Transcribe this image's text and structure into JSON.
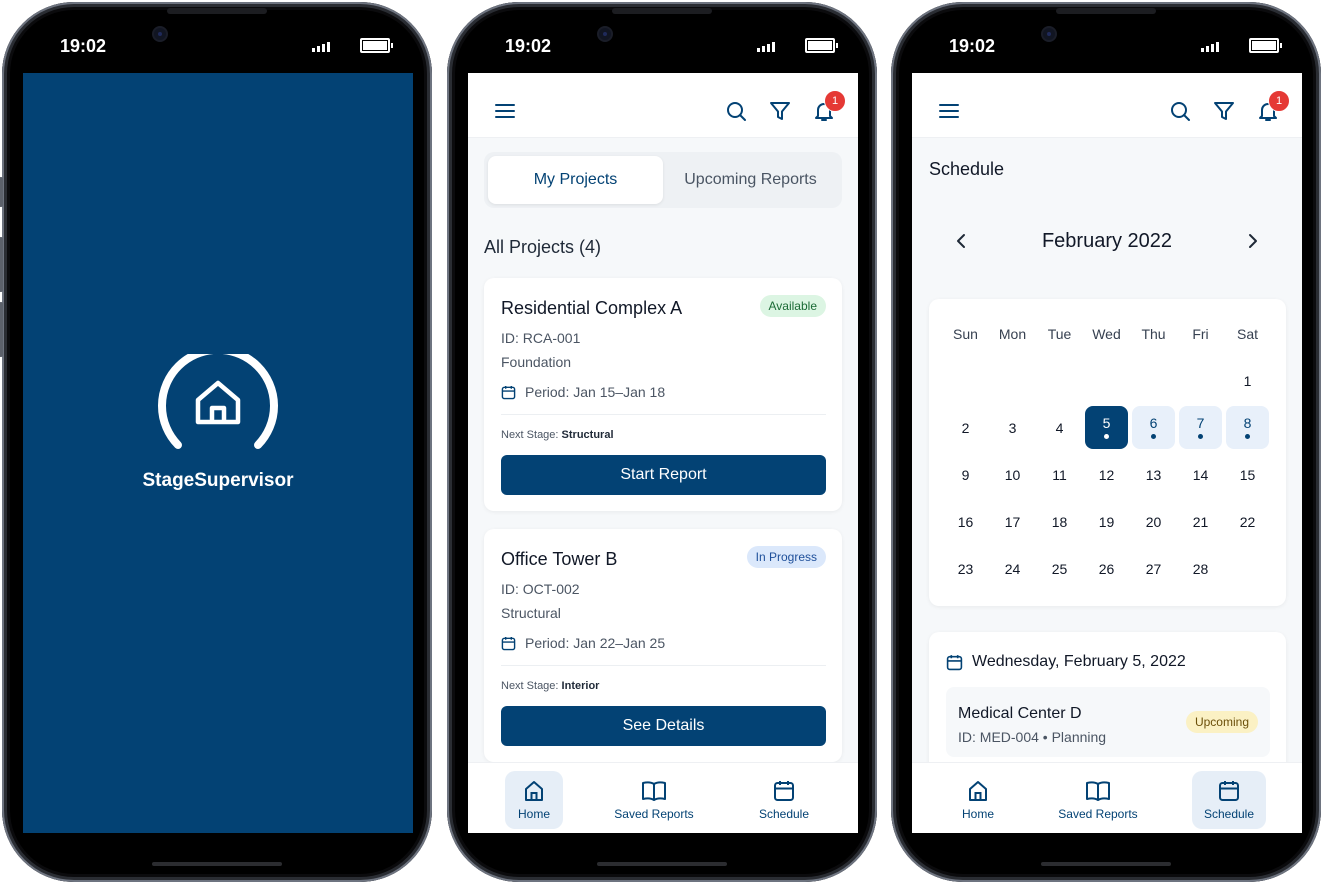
{
  "status_time": "19:02",
  "splash": {
    "app_name": "StageSupervisor",
    "logo_icon": "house-arc-icon",
    "background": "#034274"
  },
  "colors": {
    "primary": "#034274",
    "badge": "#e53935",
    "available": "#1b6b36",
    "in_progress": "#1e4f9a",
    "upcoming": "#6b4f0a"
  },
  "header": {
    "notification_count": "1",
    "icons": [
      "menu-icon",
      "search-icon",
      "filter-icon",
      "bell-icon"
    ]
  },
  "projects": {
    "tabs": [
      {
        "label": "My Projects",
        "active": true
      },
      {
        "label": "Upcoming Reports",
        "active": false
      }
    ],
    "section_title": "All Projects (4)",
    "next_stage_label": "Next Stage:",
    "cards": [
      {
        "title": "Residential Complex A",
        "id": "ID: RCA-001",
        "stage": "Foundation",
        "period": "Period: Jan 15–Jan 18",
        "next_stage": "Structural",
        "status": "Available",
        "button": "Start Report"
      },
      {
        "title": "Office Tower B",
        "id": "ID: OCT-002",
        "stage": "Structural",
        "period": "Period: Jan 22–Jan 25",
        "next_stage": "Interior",
        "status": "In Progress",
        "button": "See Details"
      }
    ]
  },
  "schedule": {
    "title": "Schedule",
    "month": "February 2022",
    "weekdays": [
      "Sun",
      "Mon",
      "Tue",
      "Wed",
      "Thu",
      "Fri",
      "Sat"
    ],
    "first_weekday_index": 6,
    "days_in_month": 28,
    "selected_day": 5,
    "event_days": [
      5,
      6,
      7,
      8
    ],
    "selected_date_label": "Wednesday, February 5, 2022",
    "event": {
      "name": "Medical Center D",
      "sub": "ID: MED-004 • Planning",
      "status": "Upcoming"
    }
  },
  "nav": [
    {
      "label": "Home",
      "icon": "home-icon"
    },
    {
      "label": "Saved Reports",
      "icon": "book-icon"
    },
    {
      "label": "Schedule",
      "icon": "calendar-icon"
    }
  ]
}
